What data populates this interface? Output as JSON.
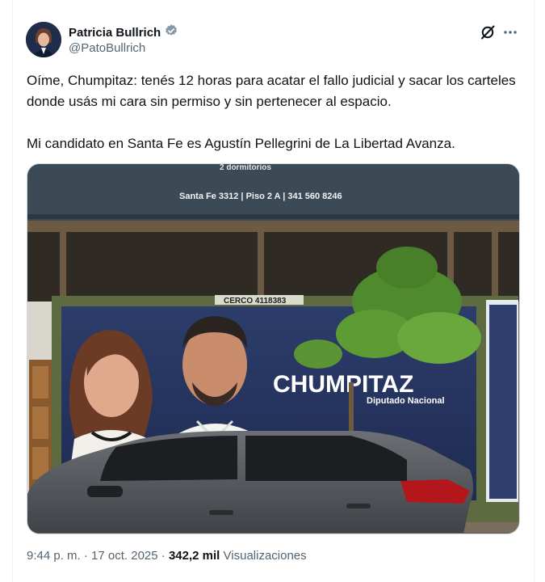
{
  "author": {
    "display_name": "Patricia Bullrich",
    "handle": "@PatoBullrich",
    "verified_color": "#829aab"
  },
  "tweet": {
    "paragraph1": "Oíme, Chumpitaz: tenés 12 horas para acatar el fallo judicial y sacar los carteles donde usás mi cara sin permiso y sin pertenecer al espacio.",
    "paragraph2": "Mi candidato en Santa Fe es Agustín Pellegrini de La Libertad Avanza."
  },
  "media": {
    "awning_text": "Santa Fe 3312 | Piso 2 A | 341 560 8246",
    "awning_partial": "2 dormitorios",
    "fence_tag": "CERCO 4118383",
    "billboard_name": "CHUMPITAZ",
    "billboard_role": "Diputado Nacional"
  },
  "meta": {
    "time": "9:44 p. m.",
    "separator": "·",
    "date": "17 oct. 2025",
    "views_count": "342,2 mil",
    "views_label": "Visualizaciones"
  },
  "icons": {
    "verified": "verified-badge-icon",
    "grok": "grok-icon",
    "more": "more-icon"
  }
}
